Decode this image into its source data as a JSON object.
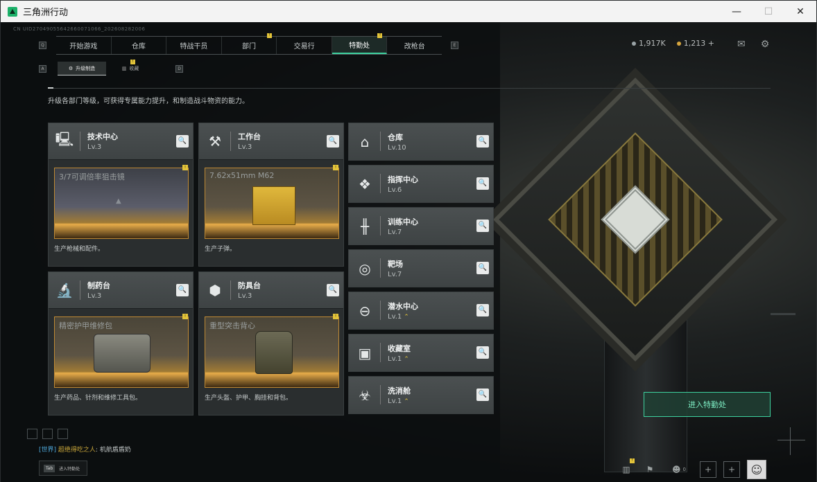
{
  "window": {
    "title": "三角洲行动",
    "min": "—",
    "max": "☐",
    "close": "✕"
  },
  "uid": "CN UID27049055642660071066_202608282006",
  "topnav": {
    "left_key": "Q",
    "right_key": "E",
    "tabs": [
      {
        "label": "开始游戏",
        "active": false,
        "badge": false
      },
      {
        "label": "仓库",
        "active": false,
        "badge": false
      },
      {
        "label": "特战干员",
        "active": false,
        "badge": false
      },
      {
        "label": "部门",
        "active": false,
        "badge": true
      },
      {
        "label": "交易行",
        "active": false,
        "badge": false
      },
      {
        "label": "特勤处",
        "active": true,
        "badge": true
      },
      {
        "label": "改枪台",
        "active": false,
        "badge": false
      }
    ],
    "badge_text": "!"
  },
  "subnav": {
    "left_key": "A",
    "right_key": "D",
    "tabs": [
      {
        "label": "升级制造",
        "active": true
      },
      {
        "label": "收藏",
        "active": false
      }
    ]
  },
  "currency": {
    "coins1": "1,917K",
    "coins2": "1,213 +",
    "coin1_color": "#9aa3a6",
    "coin2_color": "#d7a63e"
  },
  "header_icons": {
    "mail": "mail-icon",
    "settings": "gear-icon"
  },
  "description": "升级各部门等级，可获得专属能力提升，和制造战斗物资的能力。",
  "production_cards": [
    {
      "name": "技术中心",
      "level": "Lv.3",
      "icon": "computer-icon",
      "product": "3/7可调倍率狙击镜",
      "desc": "生产枪械和配件。"
    },
    {
      "name": "工作台",
      "level": "Lv.3",
      "icon": "tools-icon",
      "product": "7.62x51mm M62",
      "desc": "生产子弹。"
    },
    {
      "name": "制药台",
      "level": "Lv.3",
      "icon": "microscope-icon",
      "product": "精密护甲维修包",
      "desc": "生产药品、针剂和维修工具包。"
    },
    {
      "name": "防具台",
      "level": "Lv.3",
      "icon": "cubes-icon",
      "product": "重型突击背心",
      "desc": "生产头盔、护甲、胸挂和背包。"
    }
  ],
  "facilities": [
    {
      "name": "仓库",
      "level": "Lv.10",
      "icon": "warehouse-icon",
      "upgradable": false
    },
    {
      "name": "指挥中心",
      "level": "Lv.6",
      "icon": "command-icon",
      "upgradable": false
    },
    {
      "name": "训练中心",
      "level": "Lv.7",
      "icon": "dumbbell-icon",
      "upgradable": false
    },
    {
      "name": "靶场",
      "level": "Lv.7",
      "icon": "target-icon",
      "upgradable": false
    },
    {
      "name": "潜水中心",
      "level": "Lv.1",
      "icon": "diving-mask-icon",
      "upgradable": true
    },
    {
      "name": "收藏室",
      "level": "Lv.1",
      "icon": "collection-icon",
      "upgradable": true
    },
    {
      "name": "洗消舱",
      "level": "Lv.1",
      "icon": "hazmat-icon",
      "upgradable": true
    }
  ],
  "search_glyph": "🔍",
  "upgrade_glyph": "⌃",
  "enter_button": "进入特勤处",
  "chat": {
    "channel": "[世界]",
    "user": "超绝得吃之人",
    "message": "机航盾盾奶"
  },
  "tab_hint": {
    "key": "Tab",
    "label": "进入特勤处"
  },
  "bottom": {
    "friends_count": "0"
  }
}
